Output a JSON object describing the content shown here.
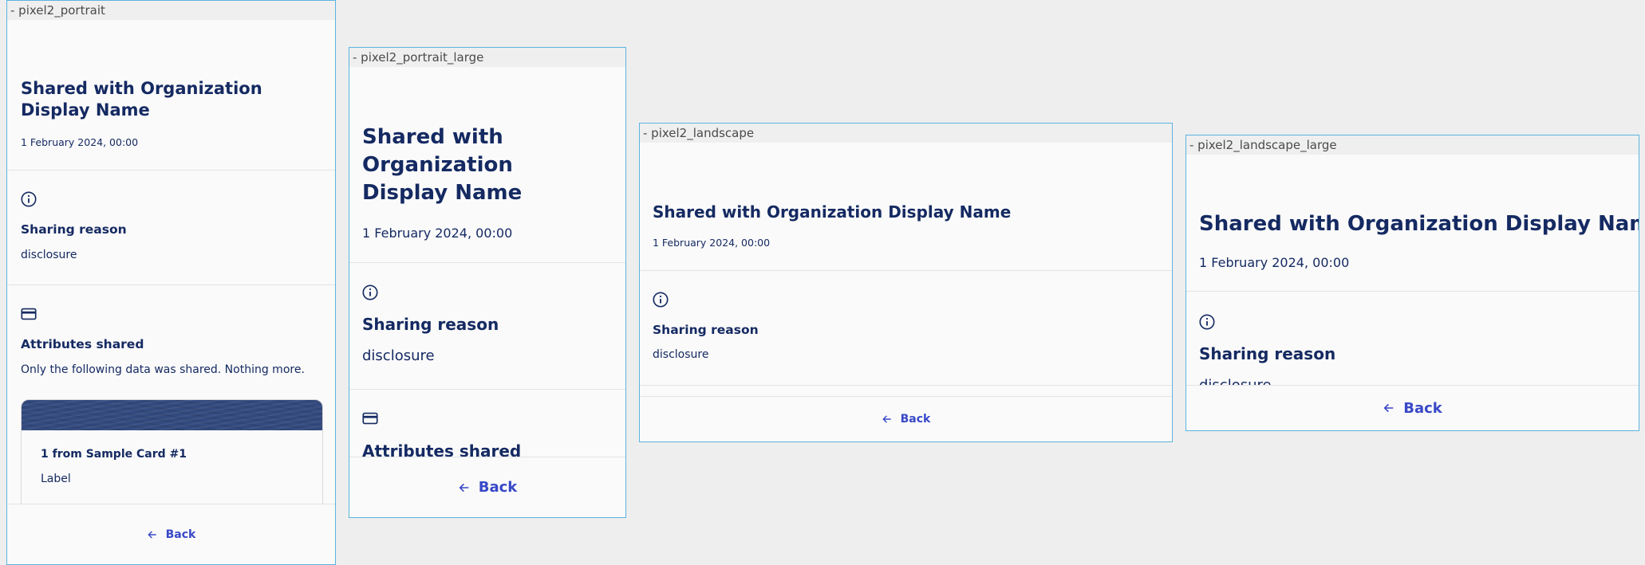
{
  "frames": {
    "portrait": {
      "label": "- pixel2_portrait",
      "title": "Shared with Organization Display Name",
      "date": "1 February 2024, 00:00",
      "reason_title": "Sharing reason",
      "reason_value": "disclosure",
      "attributes_title": "Attributes shared",
      "attributes_desc": "Only the following data was shared. Nothing more.",
      "card_item_title": "1 from Sample Card #1",
      "card_item_label": "Label",
      "back": "Back"
    },
    "portrait_large": {
      "label": "- pixel2_portrait_large",
      "title": "Shared with Organization Display Name",
      "date": "1 February 2024, 00:00",
      "reason_title": "Sharing reason",
      "reason_value": "disclosure",
      "attributes_title": "Attributes shared",
      "back": "Back"
    },
    "landscape": {
      "label": "- pixel2_landscape",
      "title": "Shared with Organization Display Name",
      "date": "1 February 2024, 00:00",
      "reason_title": "Sharing reason",
      "reason_value": "disclosure",
      "back": "Back"
    },
    "landscape_large": {
      "label": "- pixel2_landscape_large",
      "title": "Shared with Organization Display Name",
      "date": "1 February 2024, 00:00",
      "reason_title": "Sharing reason",
      "reason_value": "disclosure",
      "back": "Back"
    }
  },
  "icons": {
    "info": "info-icon",
    "card": "credit-card-icon",
    "back": "arrow-left-icon"
  },
  "colors": {
    "text": "#152a62",
    "accent": "#3848c8",
    "frame_border": "#5ab4e0",
    "card_header": "#334a7e"
  }
}
